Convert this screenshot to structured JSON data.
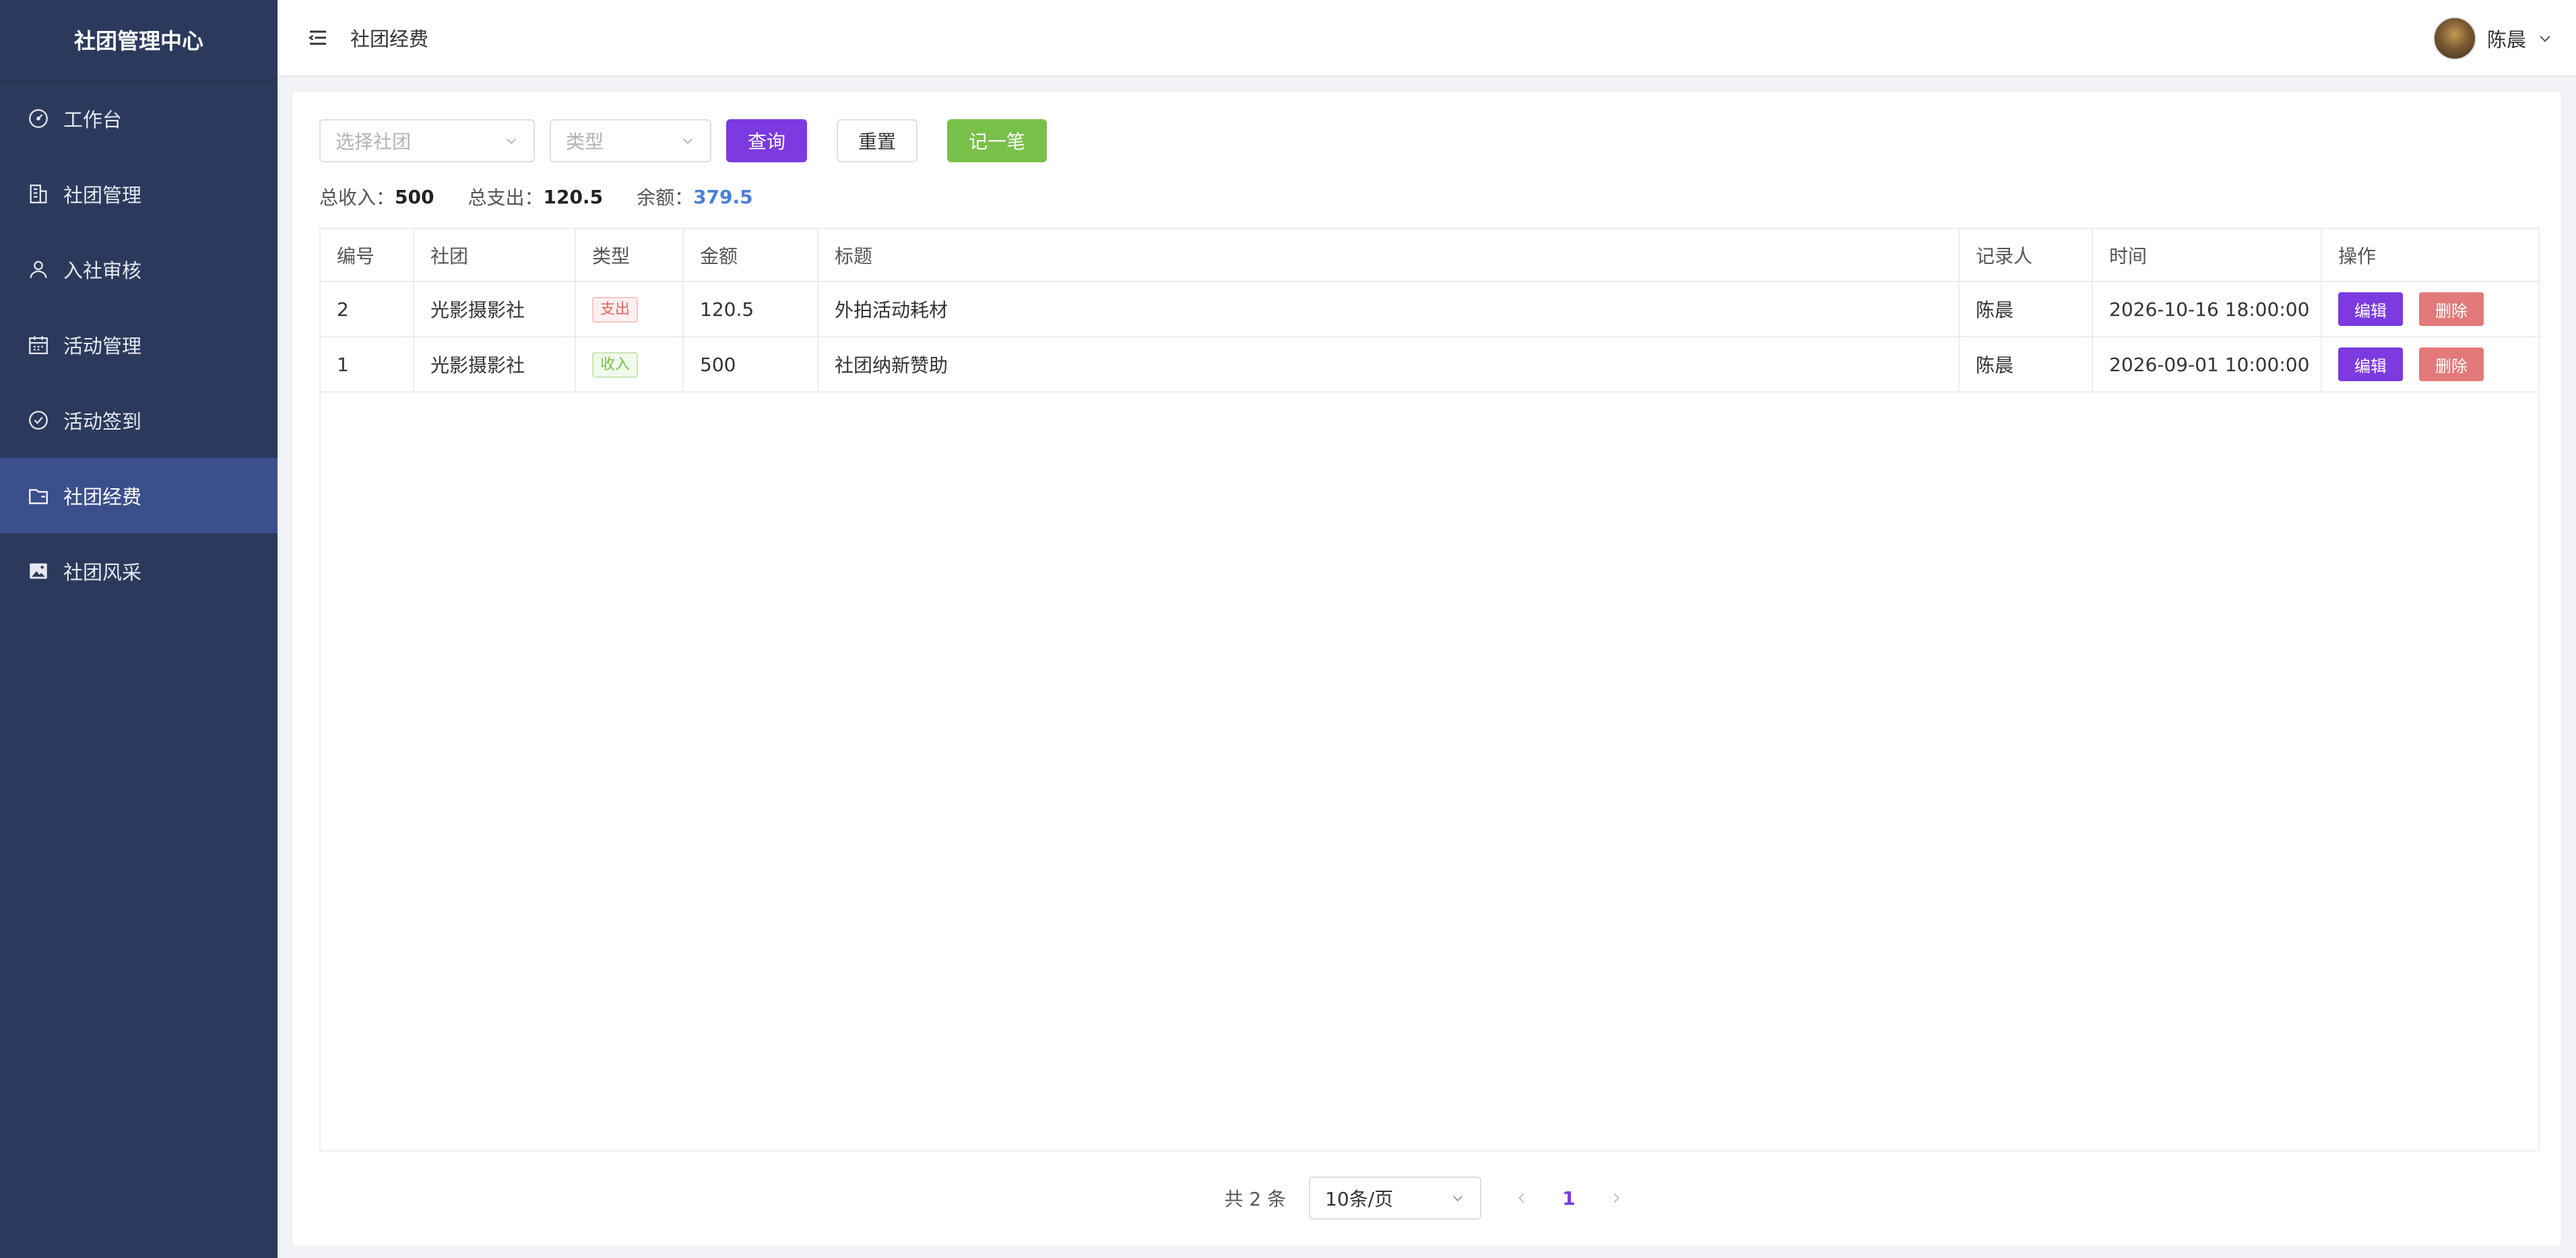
{
  "app": {
    "title": "社团管理中心"
  },
  "sidebar": {
    "items": [
      {
        "label": "工作台",
        "icon": "dashboard-icon",
        "active": false
      },
      {
        "label": "社团管理",
        "icon": "building-icon",
        "active": false
      },
      {
        "label": "入社审核",
        "icon": "user-icon",
        "active": false
      },
      {
        "label": "活动管理",
        "icon": "calendar-icon",
        "active": false
      },
      {
        "label": "活动签到",
        "icon": "check-circle-icon",
        "active": false
      },
      {
        "label": "社团经费",
        "icon": "wallet-icon",
        "active": true
      },
      {
        "label": "社团风采",
        "icon": "picture-icon",
        "active": false
      }
    ]
  },
  "header": {
    "title": "社团经费",
    "user_name": "陈晨"
  },
  "filters": {
    "club_placeholder": "选择社团",
    "type_placeholder": "类型",
    "query_label": "查询",
    "reset_label": "重置",
    "add_label": "记一笔"
  },
  "summary": {
    "income_label": "总收入：",
    "income_value": "500",
    "expense_label": "总支出：",
    "expense_value": "120.5",
    "balance_label": "余额：",
    "balance_value": "379.5"
  },
  "table": {
    "headers": [
      "编号",
      "社团",
      "类型",
      "金额",
      "标题",
      "记录人",
      "时间",
      "操作"
    ],
    "rows": [
      {
        "id": "2",
        "club": "光影摄影社",
        "type": "支出",
        "amount": "120.5",
        "title": "外拍活动耗材",
        "recorder": "陈晨",
        "time": "2026-10-16 18:00:00"
      },
      {
        "id": "1",
        "club": "光影摄影社",
        "type": "收入",
        "amount": "500",
        "title": "社团纳新赞助",
        "recorder": "陈晨",
        "time": "2026-09-01 10:00:00"
      }
    ],
    "edit_label": "编辑",
    "delete_label": "删除"
  },
  "pagination": {
    "total_text": "共 2 条",
    "page_size": "10条/页",
    "current_page": "1"
  },
  "colors": {
    "sidebar_bg": "#2b3a5c",
    "sidebar_active": "#3b4f8c",
    "primary": "#7c3ae0",
    "success": "#79c04b",
    "danger": "#e37979",
    "balance": "#4a7fd8"
  }
}
